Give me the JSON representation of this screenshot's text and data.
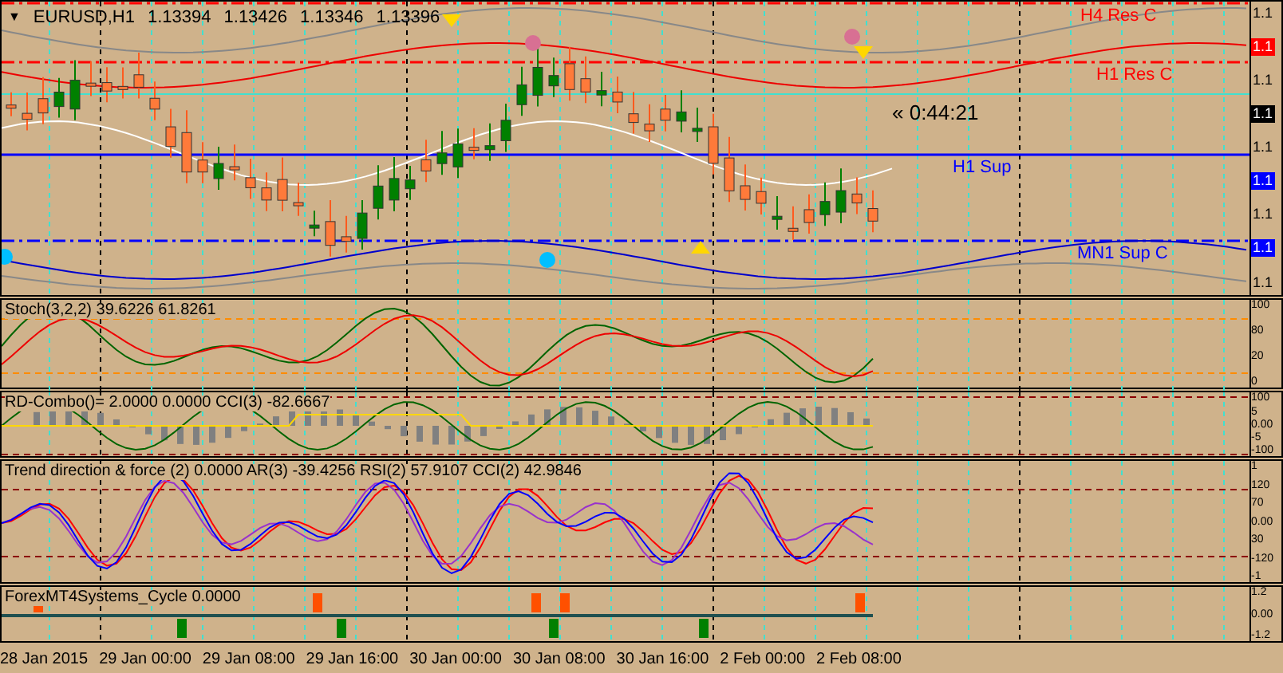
{
  "header": {
    "menu_glyph": "▼",
    "symbol": "EURUSD,H1",
    "prices": [
      "1.13394",
      "1.13426",
      "1.13346",
      "1.13396"
    ]
  },
  "levels": [
    {
      "label": "H4 Res C",
      "kind": "dashdot",
      "color": "#ff0000"
    },
    {
      "label": "H1 Res C",
      "kind": "dashdot",
      "color": "#ff0000"
    },
    {
      "label": "H1 Sup",
      "kind": "solid",
      "color": "#0000ff"
    },
    {
      "label": "MN1 Sup C",
      "kind": "dashdot",
      "color": "#0000ff"
    }
  ],
  "timer": "« 0:44:21",
  "price_axis": [
    {
      "text": "1.1",
      "kind": "plain"
    },
    {
      "text": "1.1",
      "kind": "badge",
      "color": "#ff0000"
    },
    {
      "text": "1.1",
      "kind": "plain"
    },
    {
      "text": "1.1",
      "kind": "badge",
      "color": "#000000"
    },
    {
      "text": "1.1",
      "kind": "plain"
    },
    {
      "text": "1.1",
      "kind": "badge",
      "color": "#0000ff"
    },
    {
      "text": "1.1",
      "kind": "plain"
    },
    {
      "text": "1.1",
      "kind": "badge",
      "color": "#0000ff"
    },
    {
      "text": "1.1",
      "kind": "plain"
    }
  ],
  "indicators": [
    {
      "kind": "stoch",
      "label": "Stoch(3,2,2) 39.6226 61.8261",
      "axis": [
        "100",
        "80",
        "20",
        "0"
      ]
    },
    {
      "kind": "combo",
      "label": "RD-Combo()=  2.0000 0.0000  CCI(3) -82.6667",
      "axis": [
        "100",
        "5",
        "0.00",
        "-5",
        "-100"
      ]
    },
    {
      "kind": "trend",
      "label": "Trend direction & force (2) 0.0000  AR(3) -39.4256  RSI(2) 57.9107  CCI(2) 42.9846",
      "axis": [
        "1",
        "120",
        "70",
        "0.00",
        "30",
        "-120",
        "-1"
      ]
    },
    {
      "kind": "cycle",
      "label": "ForexMT4Systems_Cycle 0.0000",
      "axis": [
        "1.2",
        "0.00",
        "-1.2"
      ]
    }
  ],
  "time_axis": [
    "28 Jan 2015",
    "29 Jan 00:00",
    "29 Jan 08:00",
    "29 Jan 16:00",
    "30 Jan 00:00",
    "30 Jan 08:00",
    "30 Jan 16:00",
    "2 Feb 00:00",
    "2 Feb 08:00"
  ]
}
